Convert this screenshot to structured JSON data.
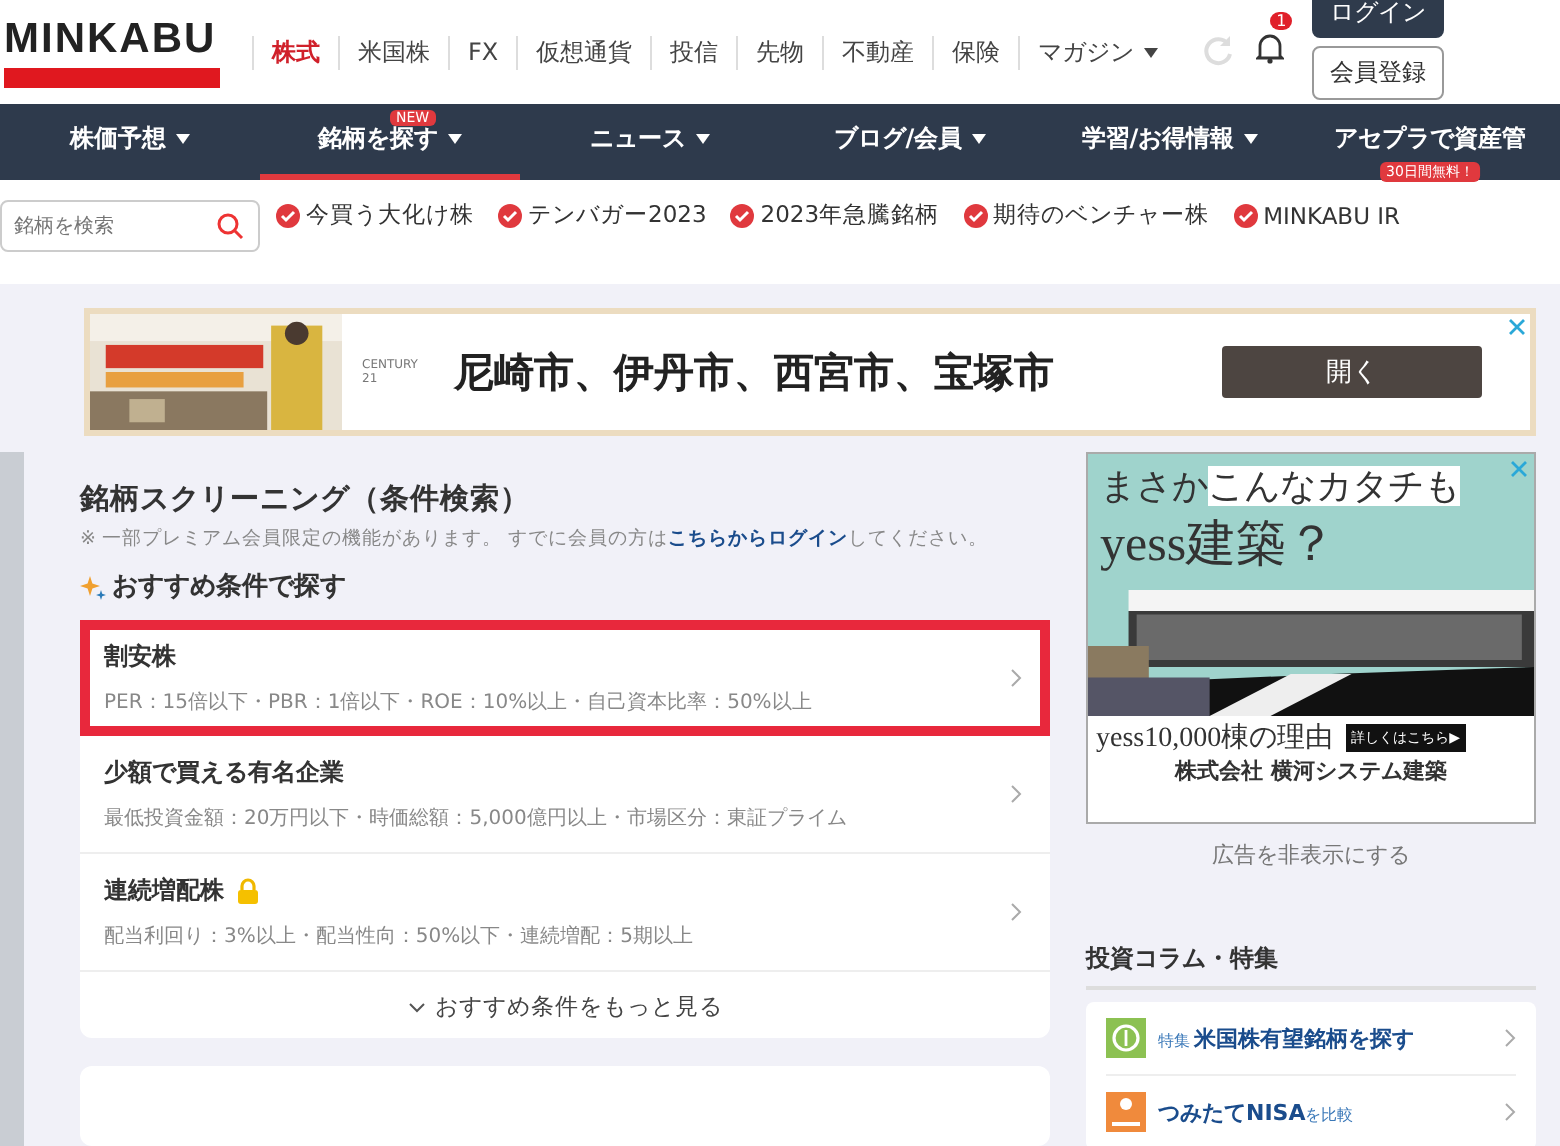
{
  "header": {
    "logo": "MINKABU",
    "links": [
      {
        "label": "株式",
        "selected": true,
        "dropdown": false
      },
      {
        "label": "米国株",
        "selected": false,
        "dropdown": false
      },
      {
        "label": "FX",
        "selected": false,
        "dropdown": false
      },
      {
        "label": "仮想通貨",
        "selected": false,
        "dropdown": false
      },
      {
        "label": "投信",
        "selected": false,
        "dropdown": false
      },
      {
        "label": "先物",
        "selected": false,
        "dropdown": false
      },
      {
        "label": "不動産",
        "selected": false,
        "dropdown": false
      },
      {
        "label": "保険",
        "selected": false,
        "dropdown": false
      },
      {
        "label": "マガジン",
        "selected": false,
        "dropdown": true
      }
    ],
    "notification_count": "1",
    "login": "ログイン",
    "register": "会員登録"
  },
  "main_nav": [
    {
      "label": "株価予想",
      "selected": false,
      "dropdown": true
    },
    {
      "label": "銘柄を探す",
      "selected": true,
      "dropdown": true,
      "badge": "NEW"
    },
    {
      "label": "ニュース",
      "selected": false,
      "dropdown": true
    },
    {
      "label": "ブログ/会員",
      "selected": false,
      "dropdown": true
    },
    {
      "label": "学習/お得情報",
      "selected": false,
      "dropdown": true
    },
    {
      "label": "アセプラで資産管",
      "selected": false,
      "dropdown": false,
      "badge": "30日間無料！"
    }
  ],
  "quick_links": {
    "search": {
      "placeholder": "銘柄を検索"
    },
    "tags": [
      "今買う大化け株",
      "テンバガー2023",
      "2023年急騰銘柄",
      "期待のベンチャー株",
      "MINKABU IR"
    ]
  },
  "ad_banner": {
    "brand": "CENTURY 21",
    "text": "尼崎市、伊丹市、西宮市、宝塚市",
    "button": "開く"
  },
  "screening": {
    "title": "銘柄スクリーニング（条件検索）",
    "note_before": "※ 一部プレミアム会員限定の機能があります。 すでに会員の方は",
    "note_link": "こちらからログイン",
    "note_after": "してください。",
    "section": "おすすめ条件で探す",
    "conditions": [
      {
        "title": "割安株",
        "criteria": "PER：15倍以下・PBR：1倍以下・ROE：10%以上・自己資本比率：50%以上",
        "highlighted": true,
        "locked": false
      },
      {
        "title": "少額で買える有名企業",
        "criteria": "最低投資金額：20万円以下・時価総額：5,000億円以上・市場区分：東証プライム",
        "highlighted": false,
        "locked": false
      },
      {
        "title": "連続増配株",
        "criteria": "配当利回り：3%以上・配当性向：50%以下・連続増配：5期以上",
        "highlighted": false,
        "locked": true
      }
    ],
    "more": "おすすめ条件をもっと見る"
  },
  "side_ad": {
    "headline_1": "まさか",
    "headline_2": "こんなカタチも",
    "headline_3": "yess建築？",
    "reason": "yess10,000棟の理由",
    "details": "詳しくはこちら▶",
    "company": "株式会社 横河システム建築"
  },
  "hide_ad": "広告を非表示にする",
  "column": {
    "title": "投資コラム・特集",
    "items": [
      {
        "kind": "coin",
        "color": "#8cc152",
        "tag": "特集",
        "label": "米国株有望銘柄を探す"
      },
      {
        "kind": "hand",
        "color": "#f08a3c",
        "label": "つみたてNISA",
        "suffix": "を比較"
      }
    ]
  }
}
